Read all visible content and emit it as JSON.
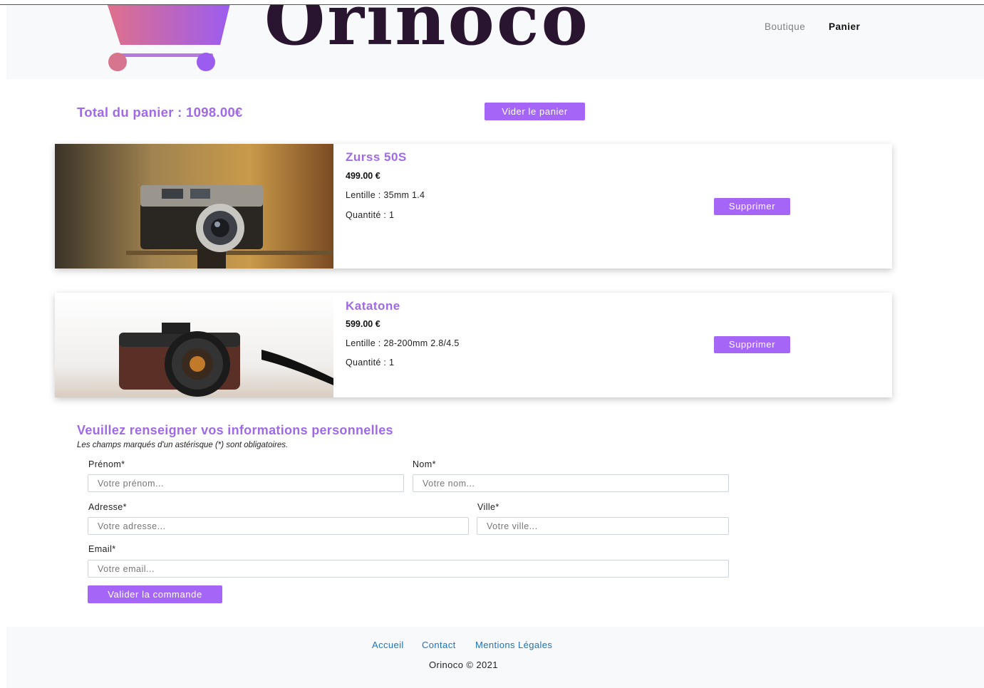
{
  "header": {
    "logo_text": "Orinoco",
    "nav": {
      "boutique": "Boutique",
      "panier": "Panier"
    }
  },
  "cart": {
    "total": "Total du panier : 1098.00€",
    "clear_button": "Vider le panier",
    "items": [
      {
        "name": "Zurss 50S",
        "price": "499.00 €",
        "lens": "Lentille : 35mm 1.4",
        "quantity": "Quantité : 1",
        "remove": "Supprimer"
      },
      {
        "name": "Katatone",
        "price": "599.00 €",
        "lens": "Lentille : 28-200mm 2.8/4.5",
        "quantity": "Quantité : 1",
        "remove": "Supprimer"
      }
    ]
  },
  "form": {
    "title": "Veuillez renseigner vos informations personnelles",
    "note": "Les champs marqués d'un astérisque (*) sont obligatoires.",
    "firstname": {
      "label": "Prénom*",
      "placeholder": "Votre prénom..."
    },
    "lastname": {
      "label": "Nom*",
      "placeholder": "Votre nom..."
    },
    "address": {
      "label": "Adresse*",
      "placeholder": "Votre adresse..."
    },
    "city": {
      "label": "Ville*",
      "placeholder": "Votre ville..."
    },
    "email": {
      "label": "Email*",
      "placeholder": "Votre email..."
    },
    "submit": "Valider la commande"
  },
  "footer": {
    "links": [
      "Accueil",
      "Contact",
      "Mentions Légales"
    ],
    "copyright": "Orinoco © 2021"
  },
  "colors": {
    "accent": "#a566f7",
    "heading": "#a06ae6",
    "link": "#1a73c0",
    "logo_text": "#2a1530",
    "header_bg": "#f8f9fa"
  }
}
